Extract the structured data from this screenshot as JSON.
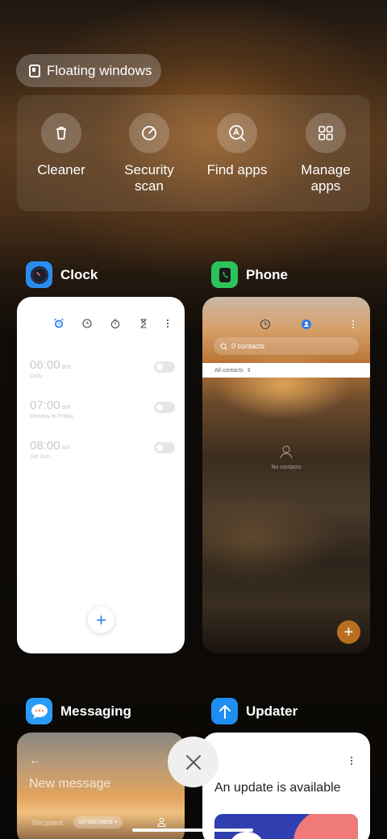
{
  "floating_windows": {
    "label": "Floating windows",
    "icon": "floating-window-icon"
  },
  "quick_actions": [
    {
      "label": "Cleaner",
      "icon": "trash-icon"
    },
    {
      "label": "Security\nscan",
      "icon": "security-scan-icon"
    },
    {
      "label": "Find apps",
      "icon": "find-apps-icon"
    },
    {
      "label": "Manage\napps",
      "icon": "grid-icon"
    }
  ],
  "apps": {
    "clock": {
      "name": "Clock",
      "icon": "clock-app-icon",
      "icon_color": "#2a8cf0",
      "alarms": [
        {
          "time": "06:00",
          "ampm": "am",
          "repeat": "Daily"
        },
        {
          "time": "07:00",
          "ampm": "am",
          "repeat": "Monday to Friday"
        },
        {
          "time": "08:00",
          "ampm": "am",
          "repeat": "Sat Sun"
        }
      ],
      "fab": "+"
    },
    "phone": {
      "name": "Phone",
      "icon": "phone-app-icon",
      "icon_color": "#2cc35a",
      "search_placeholder": "0 contacts",
      "filter_label": "All contacts",
      "empty_text": "No contacts",
      "fab": "+"
    },
    "messaging": {
      "name": "Messaging",
      "icon": "messaging-app-icon",
      "icon_color": "#2a9cf5",
      "title": "New message",
      "recipient_label": "Recipient:",
      "recipient_value": "18730218809"
    },
    "updater": {
      "name": "Updater",
      "icon": "updater-app-icon",
      "icon_color": "#1e8ef0",
      "title": "An update is available"
    }
  },
  "close_all": {
    "icon": "close-icon"
  }
}
